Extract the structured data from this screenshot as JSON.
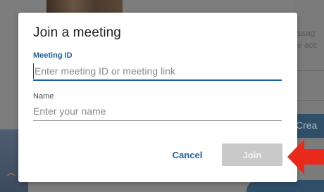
{
  "background": {
    "right_text_1": "ssag",
    "right_text_2": "e acc",
    "create_label": "Crea"
  },
  "dialog": {
    "title": "Join a meeting",
    "meeting_id": {
      "label": "Meeting ID",
      "value": "",
      "placeholder": "Enter meeting ID or meeting link"
    },
    "name": {
      "label": "Name",
      "value": "",
      "placeholder": "Enter your name"
    },
    "cancel_label": "Cancel",
    "join_label": "Join"
  },
  "annotation": {
    "arrow_color": "#e8291c",
    "arrow_icon": "arrow-left-icon"
  },
  "colors": {
    "accent": "#1d5fa6",
    "disabled_button": "#c9c9c9"
  }
}
